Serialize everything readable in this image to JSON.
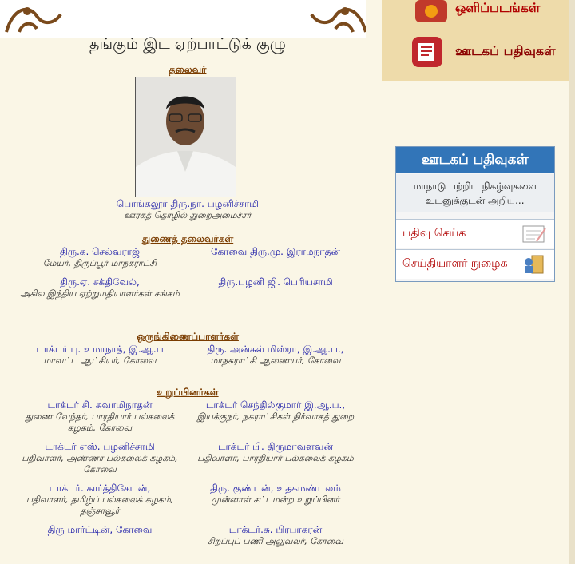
{
  "banner": {
    "title": "தங்கும் இட ஏற்பாட்டுக் குழு"
  },
  "sections": {
    "chairman": "தலைவர்",
    "vice_chairmen": "துணைத் தலைவர்கள்",
    "coordinators": "ஒருங்கிணைப்பாளர்கள்",
    "members": "உறுப்பினர்கள்"
  },
  "chairman": {
    "name": "பொங்கலூர் திரு.நா. பழனிச்சாமி",
    "role": "ஊரகத் தொழில் துறைஅமைச்சர்"
  },
  "vice": [
    {
      "name": "திரு.க. செல்வராஜ்",
      "role": "மேயர், திருப்பூர் மாநகராட்சி"
    },
    {
      "name": "கோவை திரு.மு. இராமநாதன்",
      "role": ""
    },
    {
      "name": "திரு.ஏ. சக்திவேல்,",
      "role": "அகில இந்திய ஏற்றுமதியாளர்கள் சங்கம்"
    },
    {
      "name": "திரு.பழனி ஜி. பெரியசாமி",
      "role": ""
    }
  ],
  "coord": [
    {
      "name": "டாக்டர் பு. உமாநாத், இ.ஆ.ப",
      "role": "மாவட்ட ஆட்சியர், கோவை"
    },
    {
      "name": "திரு. அன்சுல் மிஸ்ரா, இ.ஆ.ப.,",
      "role": "மாநகராட்சி ஆணையர், கோவை"
    }
  ],
  "members": [
    {
      "name": "டாக்டர் சி. சுவாமிநாதன்",
      "role": "துணை வேந்தர், பாரதியார் பல்கலைக் கழகம், கோவை"
    },
    {
      "name": "டாக்டர் செந்தில்குமார் இ.ஆ.ப.,",
      "role": "இயக்குநர், நகராட்சிகள் நிர்வாகத் துறை"
    },
    {
      "name": "டாக்டர் எஸ். பழனிச்சாமி",
      "role": "பதிவாளர், அண்ணா பல்கலைக் கழகம், கோவை"
    },
    {
      "name": "டாக்டர் பி. திருமாவளவன்",
      "role": "பதிவாளர், பாரதியார் பல்கலைக் கழகம்"
    },
    {
      "name": "டாக்டர். கார்த்திகேயன்,",
      "role": "பதிவாளர், தமிழ்ப் பல்கலைக் கழகம், தஞ்சாவூர்"
    },
    {
      "name": "திரு. குண்டன், உதகமண்டலம்",
      "role": "முன்னாள் சட்டமன்ற உறுப்பினர்"
    },
    {
      "name": "திரு மார்ட்டின், கோவை",
      "role": ""
    },
    {
      "name": "டாக்டர்.சு. பிரபாகரன்",
      "role": "சிறப்புப் பணி அலுவலர், கோவை"
    }
  ],
  "side": {
    "photos_label": "ஒளிப்படங்கள்",
    "media_reports_label": "ஊடகப் பதிவுகள்",
    "media_box": {
      "header": "ஊடகப் பதிவுகள்",
      "desc_line1": "மாநாடு பற்றிய நிகழ்வுகளை",
      "desc_line2": "உடனுக்குடன் அறிய...",
      "register": "பதிவு செய்க",
      "reporter_login": "செய்தியாளர் நுழைக"
    }
  }
}
